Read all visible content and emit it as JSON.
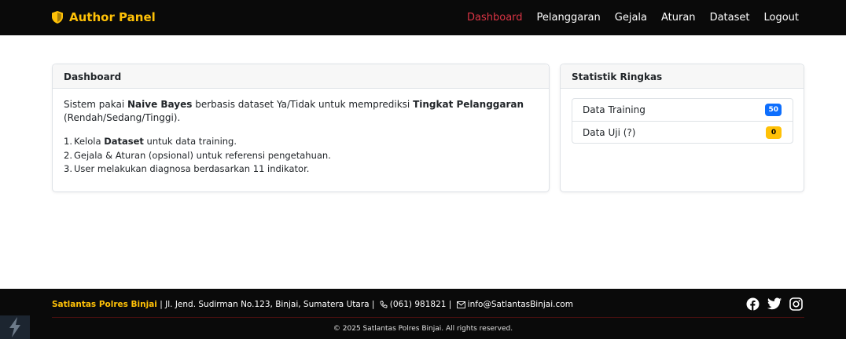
{
  "navbar": {
    "brand": "Author Panel",
    "items": [
      {
        "label": "Dashboard",
        "active": true
      },
      {
        "label": "Pelanggaran",
        "active": false
      },
      {
        "label": "Gejala",
        "active": false
      },
      {
        "label": "Aturan",
        "active": false
      },
      {
        "label": "Dataset",
        "active": false
      },
      {
        "label": "Logout",
        "active": false
      }
    ]
  },
  "dashboard": {
    "title": "Dashboard",
    "intro": {
      "p1": "Sistem pakai ",
      "b1": "Naive Bayes",
      "p2": " berbasis dataset Ya/Tidak untuk memprediksi ",
      "b2": "Tingkat Pelanggaran",
      "p3": " (Rendah/Sedang/Tinggi)."
    },
    "steps": [
      {
        "num": "1.",
        "before": "Kelola ",
        "bold": "Dataset",
        "after": " untuk data training."
      },
      {
        "num": "2.",
        "before": "Gejala & Aturan (opsional) untuk referensi pengetahuan.",
        "bold": "",
        "after": ""
      },
      {
        "num": "3.",
        "before": "User melakukan diagnosa berdasarkan 11 indikator.",
        "bold": "",
        "after": ""
      }
    ]
  },
  "stats": {
    "title": "Statistik Ringkas",
    "items": [
      {
        "label": "Data Training",
        "value": "50",
        "color": "#0d6efd"
      },
      {
        "label": "Data Uji (?)",
        "value": "0",
        "color": "#ffc107"
      }
    ]
  },
  "footer": {
    "org": "Satlantas Polres Binjai",
    "address": " | Jl. Jend. Sudirman No.123, Binjai, Sumatera Utara | ",
    "phone": "(061) 981821",
    "sep": " | ",
    "email": "info@SatlantasBinjai.com",
    "copyright": "© 2025 Satlantas Polres Binjai. All rights reserved.",
    "socials": [
      "facebook-icon",
      "twitter-icon",
      "instagram-icon"
    ]
  },
  "colors": {
    "accent": "#ffc107",
    "active_nav": "#dc3545",
    "navbar_bg": "#0a0a0a"
  }
}
